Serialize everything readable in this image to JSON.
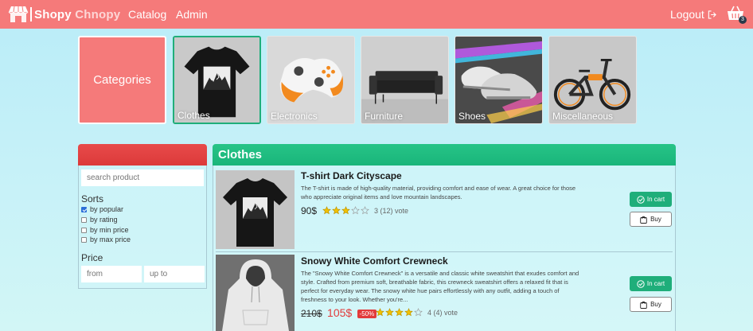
{
  "header": {
    "brand_primary": "Shopy",
    "brand_secondary": "Chnopy",
    "nav": [
      "Catalog",
      "Admin"
    ],
    "logout_label": "Logout",
    "cart_count": "3"
  },
  "categories": {
    "title": "Categories",
    "items": [
      {
        "label": "Clothes",
        "active": true
      },
      {
        "label": "Electronics"
      },
      {
        "label": "Furniture"
      },
      {
        "label": "Shoes"
      },
      {
        "label": "Miscellaneous"
      }
    ]
  },
  "filters": {
    "search_placeholder": "search product",
    "sorts_title": "Sorts",
    "sorts": [
      {
        "label": "by popular",
        "checked": true
      },
      {
        "label": "by rating",
        "checked": false
      },
      {
        "label": "by min price",
        "checked": false
      },
      {
        "label": "by max price",
        "checked": false
      }
    ],
    "price_title": "Price",
    "price_from_placeholder": "from",
    "price_to_placeholder": "up to"
  },
  "products_section": {
    "title": "Clothes",
    "items": [
      {
        "title": "T-shirt Dark Cityscape",
        "description": "The T-shirt is made of high-quality material, providing comfort and ease of wear. A great choice for those who appreciate original items and love mountain landscapes.",
        "price": "90$",
        "rating": 3,
        "rating_text": "3  (12) vote",
        "in_cart_label": "In cart",
        "buy_label": "Buy"
      },
      {
        "title": "Snowy White Comfort Crewneck",
        "description": "The \"Snowy White Comfort Crewneck\" is a versatile and classic white sweatshirt that exudes comfort and style. Crafted from premium soft, breathable fabric, this crewneck sweatshirt offers a relaxed fit that is perfect for everyday wear. The snowy white hue pairs effortlessly with any outfit, adding a touch of freshness to your look. Whether you're...",
        "old_price": "210$",
        "new_price": "105$",
        "discount": "-50%",
        "rating": 4,
        "rating_text": "4  (4) vote",
        "in_cart_label": "In cart",
        "buy_label": "Buy"
      }
    ]
  },
  "colors": {
    "header_bg": "#f57a7a",
    "accent_green": "#1fae7a",
    "filter_red": "#e84a4a",
    "star_yellow": "#f2c200",
    "sale_red": "#e23b3b"
  }
}
